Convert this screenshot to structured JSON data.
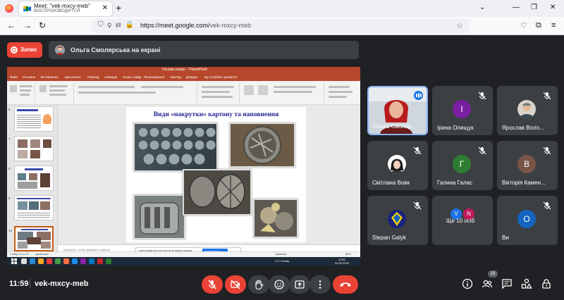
{
  "browser": {
    "tab_title": "Meet: \"vek-mxcy-meb\"",
    "tab_subtitle": "ВОСПРОИЗВОДИТСЯ",
    "url_host": "https://meet.google.com/",
    "url_path": "vek-mxcy-meb"
  },
  "meet": {
    "record_label": "Запис",
    "presenting_text": "Ольга Смолярська на екрані",
    "clock": "11:59",
    "meeting_code": "vek-mxcy-meb",
    "participant_count": "19"
  },
  "presentation": {
    "window_title": "Ознаки шлаку – PowerPoint",
    "menu": [
      "Файл",
      "Основне",
      "Вставлення",
      "Креслення",
      "Перехід",
      "Анімація",
      "Показ слайд",
      "Рецензування",
      "Вигляд",
      "Довідка",
      "Що потрібно зробити?"
    ],
    "slide_title": "Види «накрутки» картону та наповнення",
    "notes_placeholder": "Щелкните, чтобы добавить заметки",
    "share_notice": "meet.google.com ест доступ до вашого екрана.",
    "share_stop": "Закрити доступ",
    "status_left": "Слайд 10 из 20",
    "status_lang": "українська",
    "status_notes": "Примітки",
    "status_zoom": "88%",
    "taskbar_weather": "2°C Cloudy",
    "taskbar_time": "11:59",
    "taskbar_date": "24.02.2023",
    "thumb_numbers": [
      "6",
      "7",
      "8",
      "9",
      "10",
      "11"
    ]
  },
  "participants": [
    {
      "name": "Ольга Смоляр...",
      "kind": "photo",
      "speaking": true
    },
    {
      "name": "Ірина Олищук",
      "kind": "letter",
      "letter": "І",
      "color": "#7b1fa2"
    },
    {
      "name": "Ярослав Воло...",
      "kind": "photo"
    },
    {
      "name": "Світлана Вовк",
      "kind": "photo"
    },
    {
      "name": "Галина Галас",
      "kind": "letter",
      "letter": "Г",
      "color": "#2e7d32"
    },
    {
      "name": "Вікторія Камен...",
      "kind": "letter",
      "letter": "В",
      "color": "#795548"
    },
    {
      "name": "Stepan Galyk",
      "kind": "photo"
    },
    {
      "name": "Ще 10 осіб",
      "kind": "group",
      "letters": [
        "V",
        "N"
      ],
      "colors": [
        "#1a73e8",
        "#c2185b"
      ]
    },
    {
      "name": "Ви",
      "kind": "letter",
      "letter": "O",
      "color": "#1565c0"
    }
  ],
  "colors": {
    "meet_bg": "#202124",
    "tile_bg": "#3c4043",
    "red": "#ea4335",
    "accent": "#8ab4f8",
    "ppt_brand": "#b7472a"
  },
  "icons": [
    "firefox-icon",
    "meet-favicon",
    "close-icon",
    "plus-icon",
    "back-icon",
    "forward-icon",
    "reload-icon",
    "shield-icon",
    "lock-icon",
    "star-icon",
    "mic-off-icon",
    "camera-off-icon",
    "hand-icon",
    "emoji-icon",
    "present-icon",
    "more-icon",
    "hangup-icon",
    "info-icon",
    "people-icon",
    "chat-icon",
    "activities-icon",
    "host-controls-icon"
  ]
}
